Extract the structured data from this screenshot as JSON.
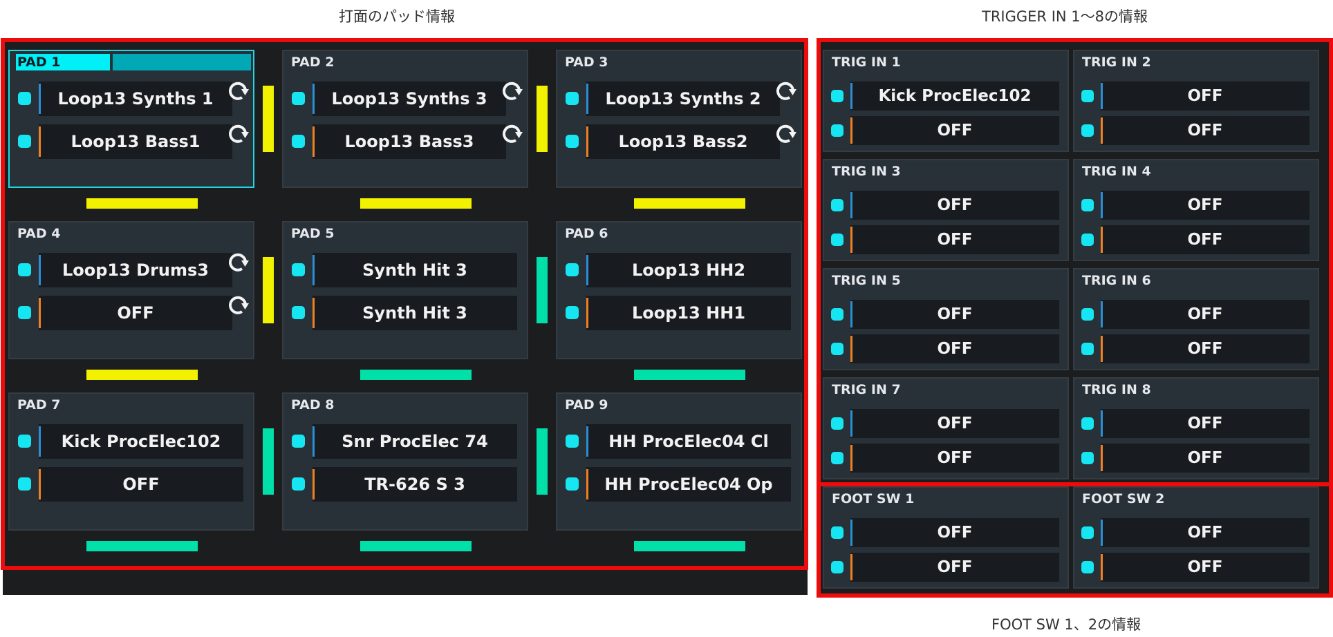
{
  "captions": {
    "pads": "打面のパッド情報",
    "trigger": "TRIGGER IN 1〜8の情報",
    "foot": "FOOT SW 1、2の情報"
  },
  "colors": {
    "cyan": "#16e6f2",
    "yellow": "#f2f200",
    "teal": "#00e0a8",
    "blue_bar": "#2a8fd6",
    "orange_bar": "#f08020",
    "frame_red": "#ee0b0b"
  },
  "pads": [
    {
      "title": "PAD 1",
      "selected": true,
      "slot_a": "Loop13 Synths 1",
      "slot_b": "Loop13 Bass1",
      "loop_a": true,
      "loop_b": true,
      "side_color": "yellow",
      "bottom_color": "yellow"
    },
    {
      "title": "PAD 2",
      "selected": false,
      "slot_a": "Loop13 Synths 3",
      "slot_b": "Loop13 Bass3",
      "loop_a": true,
      "loop_b": true,
      "side_color": "yellow",
      "bottom_color": "yellow"
    },
    {
      "title": "PAD 3",
      "selected": false,
      "slot_a": "Loop13 Synths 2",
      "slot_b": "Loop13 Bass2",
      "loop_a": true,
      "loop_b": true,
      "side_color": "none",
      "bottom_color": "yellow"
    },
    {
      "title": "PAD 4",
      "selected": false,
      "slot_a": "Loop13 Drums3",
      "slot_b": "OFF",
      "loop_a": true,
      "loop_b": true,
      "side_color": "yellow",
      "bottom_color": "yellow"
    },
    {
      "title": "PAD 5",
      "selected": false,
      "slot_a": "Synth Hit 3",
      "slot_b": "Synth Hit 3",
      "loop_a": false,
      "loop_b": false,
      "side_color": "teal",
      "bottom_color": "teal"
    },
    {
      "title": "PAD 6",
      "selected": false,
      "slot_a": "Loop13 HH2",
      "slot_b": "Loop13 HH1",
      "loop_a": false,
      "loop_b": false,
      "side_color": "none",
      "bottom_color": "teal"
    },
    {
      "title": "PAD 7",
      "selected": false,
      "slot_a": "Kick ProcElec102",
      "slot_b": "OFF",
      "loop_a": false,
      "loop_b": false,
      "side_color": "teal",
      "bottom_color": "teal"
    },
    {
      "title": "PAD 8",
      "selected": false,
      "slot_a": "Snr ProcElec 74",
      "slot_b": "TR-626 S 3",
      "loop_a": false,
      "loop_b": false,
      "side_color": "teal",
      "bottom_color": "teal"
    },
    {
      "title": "PAD 9",
      "selected": false,
      "slot_a": "HH ProcElec04 Cl",
      "slot_b": "HH ProcElec04 Op",
      "loop_a": false,
      "loop_b": false,
      "side_color": "none",
      "bottom_color": "teal"
    }
  ],
  "triggers": [
    {
      "title": "TRIG IN 1",
      "slot_a": "Kick ProcElec102",
      "slot_b": "OFF"
    },
    {
      "title": "TRIG IN 2",
      "slot_a": "OFF",
      "slot_b": "OFF"
    },
    {
      "title": "TRIG IN 3",
      "slot_a": "OFF",
      "slot_b": "OFF"
    },
    {
      "title": "TRIG IN 4",
      "slot_a": "OFF",
      "slot_b": "OFF"
    },
    {
      "title": "TRIG IN 5",
      "slot_a": "OFF",
      "slot_b": "OFF"
    },
    {
      "title": "TRIG IN 6",
      "slot_a": "OFF",
      "slot_b": "OFF"
    },
    {
      "title": "TRIG IN 7",
      "slot_a": "OFF",
      "slot_b": "OFF"
    },
    {
      "title": "TRIG IN 8",
      "slot_a": "OFF",
      "slot_b": "OFF"
    }
  ],
  "foot_switches": [
    {
      "title": "FOOT SW 1",
      "slot_a": "OFF",
      "slot_b": "OFF"
    },
    {
      "title": "FOOT SW 2",
      "slot_a": "OFF",
      "slot_b": "OFF"
    }
  ],
  "icons": {
    "loop": "loop-icon",
    "pad_led": "pad-led-icon"
  }
}
